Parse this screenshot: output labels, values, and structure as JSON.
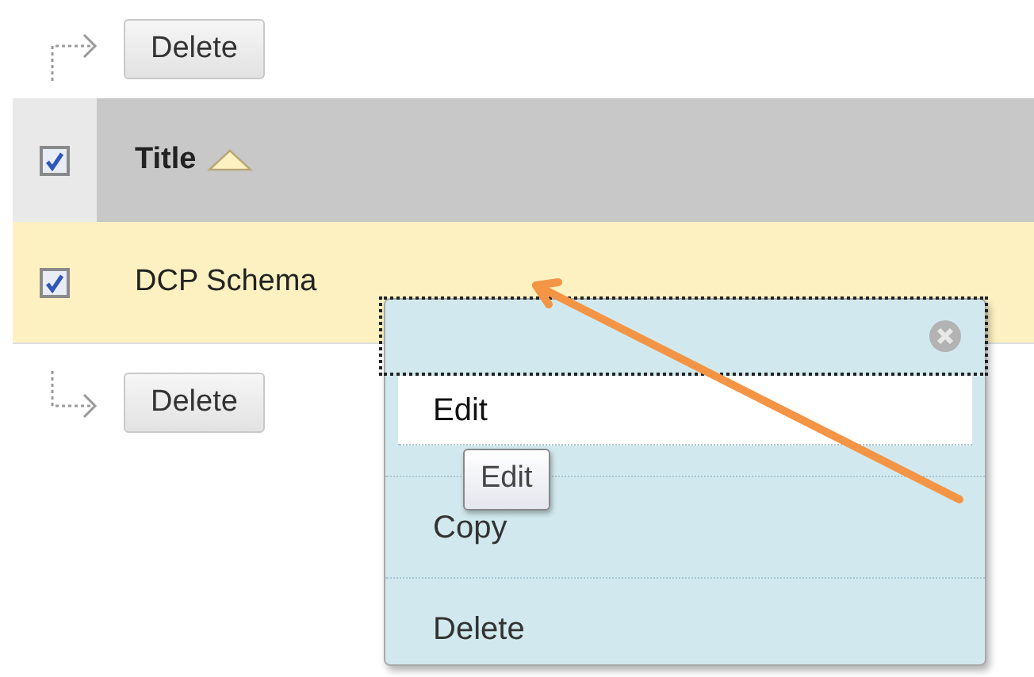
{
  "top_action": {
    "label": "Delete"
  },
  "table": {
    "select_all_checked": true,
    "columns": [
      {
        "label": "Title",
        "sorted": true
      }
    ],
    "rows": [
      {
        "title": "DCP Schema",
        "checked": true,
        "highlighted": true
      }
    ]
  },
  "bottom_action": {
    "label": "Delete"
  },
  "context_menu": {
    "items": [
      {
        "label": "Edit",
        "selected": true
      },
      {
        "label": "Copy",
        "selected": false
      },
      {
        "label": "Delete",
        "selected": false
      }
    ]
  },
  "tooltip": {
    "text": "Edit"
  }
}
